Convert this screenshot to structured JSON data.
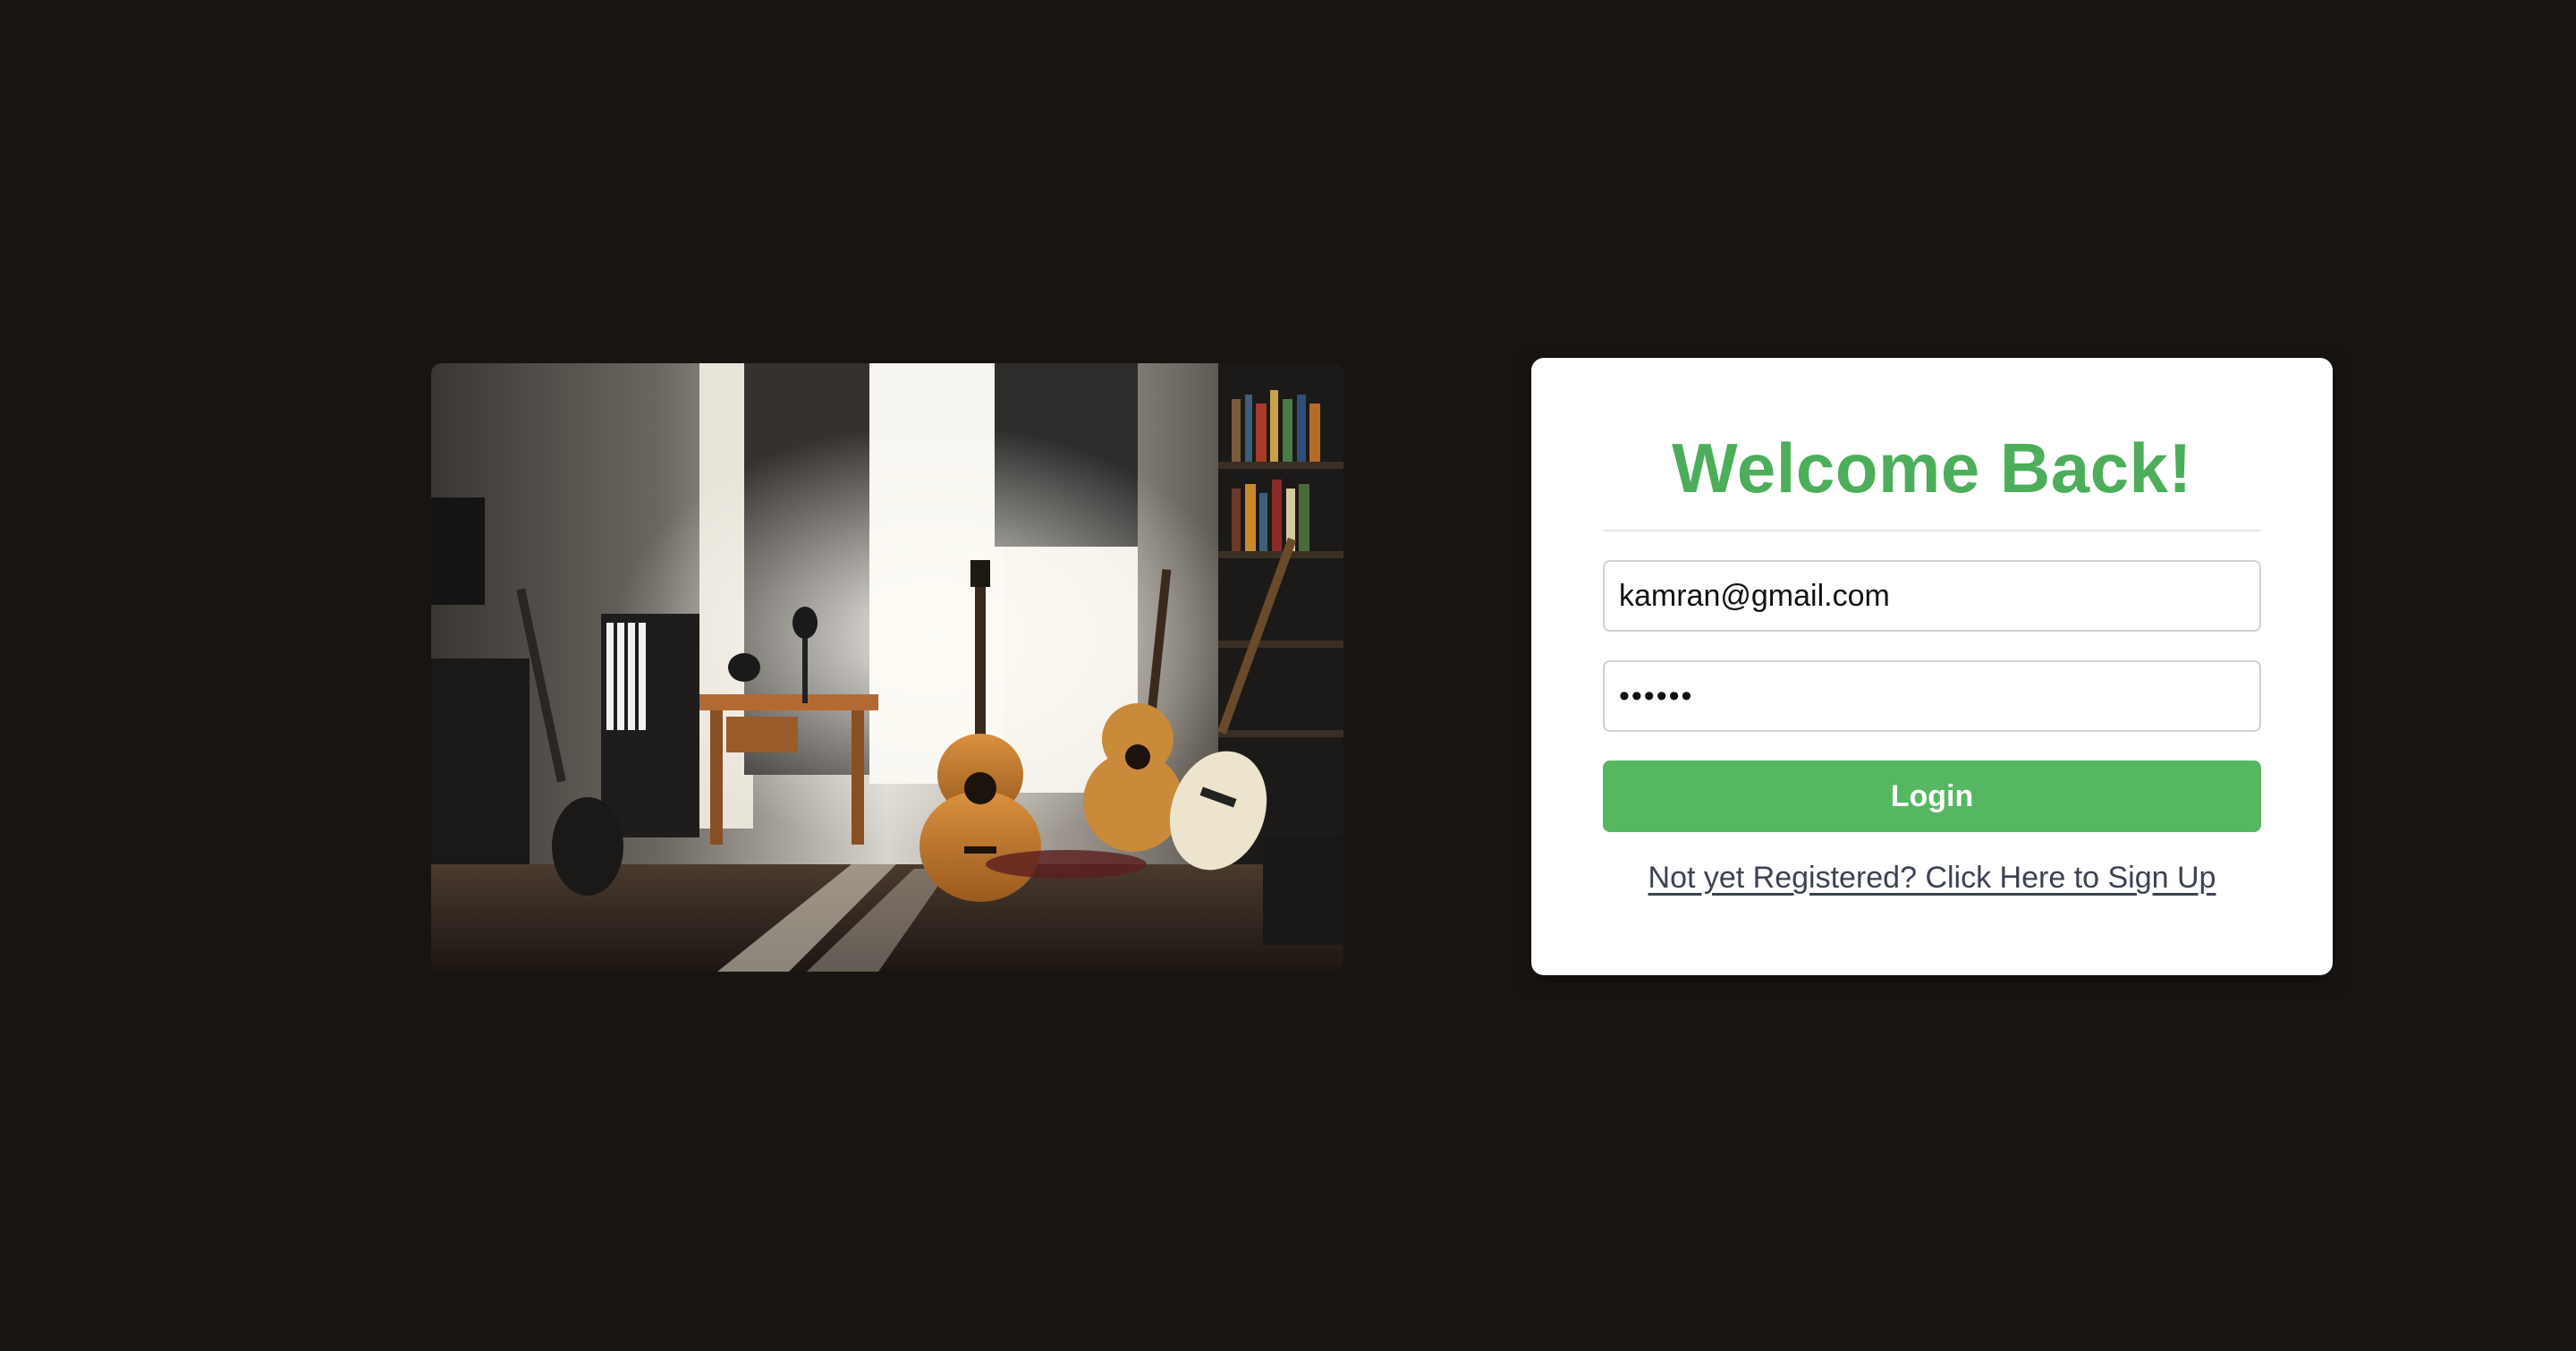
{
  "photo": {
    "description_icon": "music-room-photo"
  },
  "login": {
    "title": "Welcome Back!",
    "email_value": "kamran@gmail.com",
    "password_value": "••••••",
    "button_label": "Login",
    "signup_link": "Not yet Registered? Click Here to Sign Up"
  },
  "colors": {
    "accent": "#56b762",
    "title": "#4cae5a",
    "background": "#171412",
    "link": "#3c4252"
  }
}
